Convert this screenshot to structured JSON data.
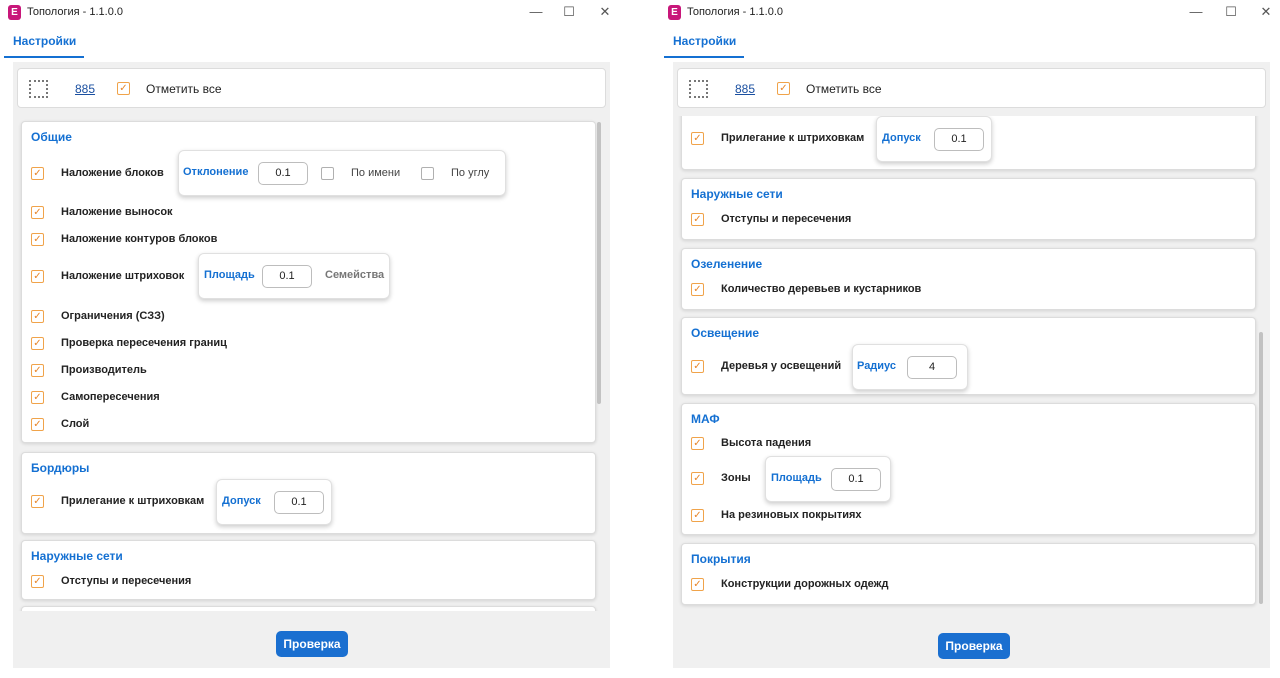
{
  "window": {
    "title": "Топология - 1.1.0.0",
    "controls": {
      "minimize": "—",
      "maximize": "☐",
      "close": "✕"
    }
  },
  "tabs": {
    "settings": "Настройки"
  },
  "toolbar": {
    "count": "885",
    "select_all": "Отметить все",
    "select_all_checked": true
  },
  "labels": {
    "deviation": "Отклонение",
    "by_name": "По имени",
    "by_angle": "По углу",
    "area": "Площадь",
    "families": "Семейства",
    "tolerance": "Допуск",
    "radius": "Радиус"
  },
  "left": {
    "general": {
      "title": "Общие",
      "items": [
        "Наложение блоков",
        "Наложение выносок",
        "Наложение контуров блоков",
        "Наложение штриховок",
        "Ограничения (СЗЗ)",
        "Проверка пересечения границ",
        "Производитель",
        "Самопересечения",
        "Слой"
      ],
      "deviation_value": "0.1",
      "area_value": "0.1"
    },
    "borders": {
      "title": "Бордюры",
      "item": "Прилегание к штриховкам",
      "tolerance_value": "0.1"
    },
    "external": {
      "title": "Наружные сети",
      "item": "Отступы и пересечения"
    }
  },
  "right": {
    "borders_item": "Прилегание к штриховкам",
    "borders_tolerance_value": "0.1",
    "external": {
      "title": "Наружные сети",
      "item": "Отступы и пересечения"
    },
    "greening": {
      "title": "Озеленение",
      "item": "Количество деревьев и кустарников"
    },
    "lighting": {
      "title": "Освещение",
      "item": "Деревья у освещений",
      "radius_value": "4"
    },
    "maf": {
      "title": "МАФ",
      "items": [
        "Высота падения",
        "Зоны",
        "На резиновых покрытиях"
      ],
      "area_value": "0.1"
    },
    "coverings": {
      "title": "Покрытия",
      "item": "Конструкции дорожных одежд"
    }
  },
  "actions": {
    "check": "Проверка"
  }
}
